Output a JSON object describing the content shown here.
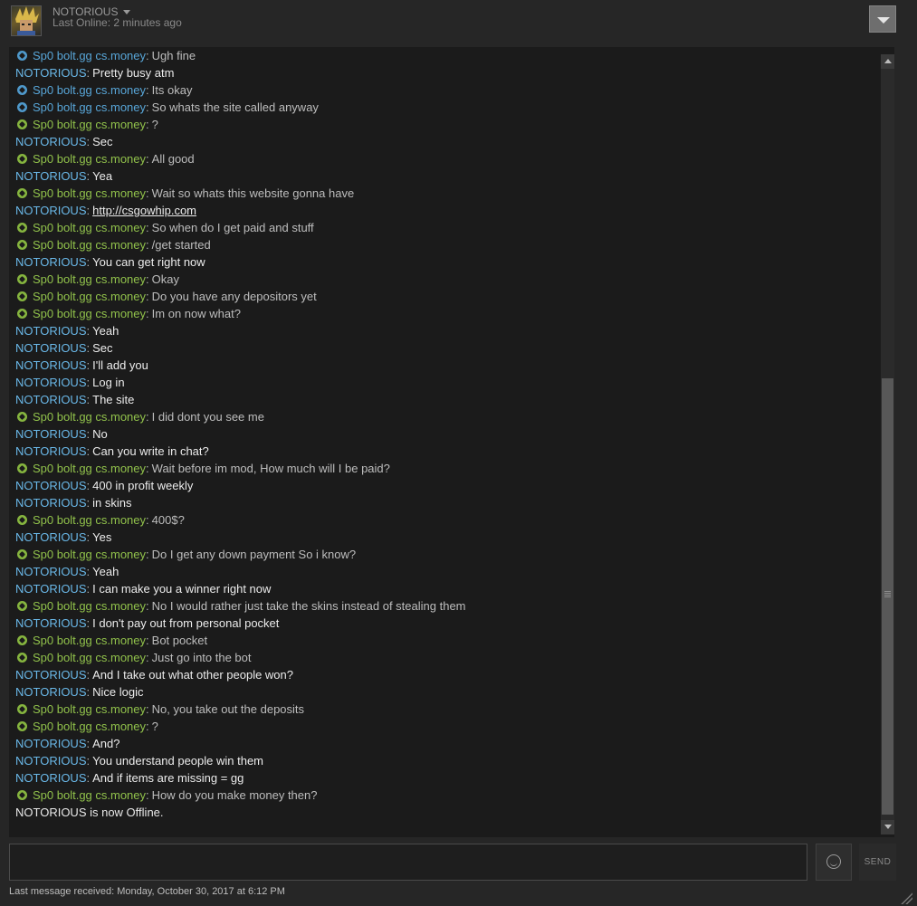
{
  "header": {
    "username": "NOTORIOUS",
    "status": "Last Online: 2 minutes ago"
  },
  "colors": {
    "friend_green": "#91c24b",
    "friend_blue": "#58a6d8",
    "self_name": "#6ab8e8",
    "background": "#1b1b1b"
  },
  "messages": [
    {
      "sender": "Sp0 bolt.gg cs.money",
      "icon": "blue",
      "text": "Ugh fine"
    },
    {
      "sender": "NOTORIOUS",
      "text": "Pretty busy atm"
    },
    {
      "sender": "Sp0 bolt.gg cs.money",
      "icon": "blue",
      "text": "Its okay"
    },
    {
      "sender": "Sp0 bolt.gg cs.money",
      "icon": "blue",
      "text": "So whats the site called anyway"
    },
    {
      "sender": "Sp0 bolt.gg cs.money",
      "icon": "green",
      "text": "?"
    },
    {
      "sender": "NOTORIOUS",
      "text": "Sec"
    },
    {
      "sender": "Sp0 bolt.gg cs.money",
      "icon": "green",
      "text": "All good"
    },
    {
      "sender": "NOTORIOUS",
      "text": "Yea"
    },
    {
      "sender": "Sp0 bolt.gg cs.money",
      "icon": "green",
      "text": "Wait so whats this website gonna have"
    },
    {
      "sender": "NOTORIOUS",
      "text": "http://csgowhip.com",
      "link": true
    },
    {
      "sender": "Sp0 bolt.gg cs.money",
      "icon": "green",
      "text": "So when do I get paid and stuff"
    },
    {
      "sender": "Sp0 bolt.gg cs.money",
      "icon": "green",
      "text": "/get started"
    },
    {
      "sender": "NOTORIOUS",
      "text": "You can get right now"
    },
    {
      "sender": "Sp0 bolt.gg cs.money",
      "icon": "green",
      "text": "Okay"
    },
    {
      "sender": "Sp0 bolt.gg cs.money",
      "icon": "green",
      "text": "Do you have any depositors yet"
    },
    {
      "sender": "Sp0 bolt.gg cs.money",
      "icon": "green",
      "text": "Im on now what?"
    },
    {
      "sender": "NOTORIOUS",
      "text": "Yeah"
    },
    {
      "sender": "NOTORIOUS",
      "text": "Sec"
    },
    {
      "sender": "NOTORIOUS",
      "text": "I'll add you"
    },
    {
      "sender": "NOTORIOUS",
      "text": "Log in"
    },
    {
      "sender": "NOTORIOUS",
      "text": "The site"
    },
    {
      "sender": "Sp0 bolt.gg cs.money",
      "icon": "green",
      "text": "I did dont you see me"
    },
    {
      "sender": "NOTORIOUS",
      "text": "No"
    },
    {
      "sender": "NOTORIOUS",
      "text": "Can you write in chat?"
    },
    {
      "sender": "Sp0 bolt.gg cs.money",
      "icon": "green",
      "text": "Wait before im mod, How much will I be paid?"
    },
    {
      "sender": "NOTORIOUS",
      "text": "400 in profit weekly"
    },
    {
      "sender": "NOTORIOUS",
      "text": "in skins"
    },
    {
      "sender": "Sp0 bolt.gg cs.money",
      "icon": "green",
      "text": "400$?"
    },
    {
      "sender": "NOTORIOUS",
      "text": "Yes"
    },
    {
      "sender": "Sp0 bolt.gg cs.money",
      "icon": "green",
      "text": "Do I get any down payment So i know?"
    },
    {
      "sender": "NOTORIOUS",
      "text": "Yeah"
    },
    {
      "sender": "NOTORIOUS",
      "text": "I can make you a winner right now"
    },
    {
      "sender": "Sp0 bolt.gg cs.money",
      "icon": "green",
      "text": "No I would rather just take the skins instead of stealing them"
    },
    {
      "sender": "NOTORIOUS",
      "text": "I don't pay out from personal pocket"
    },
    {
      "sender": "Sp0 bolt.gg cs.money",
      "icon": "green",
      "text": "Bot pocket"
    },
    {
      "sender": "Sp0 bolt.gg cs.money",
      "icon": "green",
      "text": "Just go into the bot"
    },
    {
      "sender": "NOTORIOUS",
      "text": "And I take out what other people won?"
    },
    {
      "sender": "NOTORIOUS",
      "text": "Nice logic"
    },
    {
      "sender": "Sp0 bolt.gg cs.money",
      "icon": "green",
      "text": "No, you take out the deposits"
    },
    {
      "sender": "Sp0 bolt.gg cs.money",
      "icon": "green",
      "text": "?"
    },
    {
      "sender": "NOTORIOUS",
      "text": "And?"
    },
    {
      "sender": "NOTORIOUS",
      "text": "You understand people win them"
    },
    {
      "sender": "NOTORIOUS",
      "text": "And if items are missing = gg"
    },
    {
      "sender": "Sp0 bolt.gg cs.money",
      "icon": "green",
      "text": "How do you make money then?"
    }
  ],
  "system_message": "NOTORIOUS is now Offline.",
  "composer": {
    "value": "",
    "send_label": "SEND"
  },
  "footer": {
    "last_message": "Last message received: Monday, October 30, 2017 at 6:12 PM"
  }
}
